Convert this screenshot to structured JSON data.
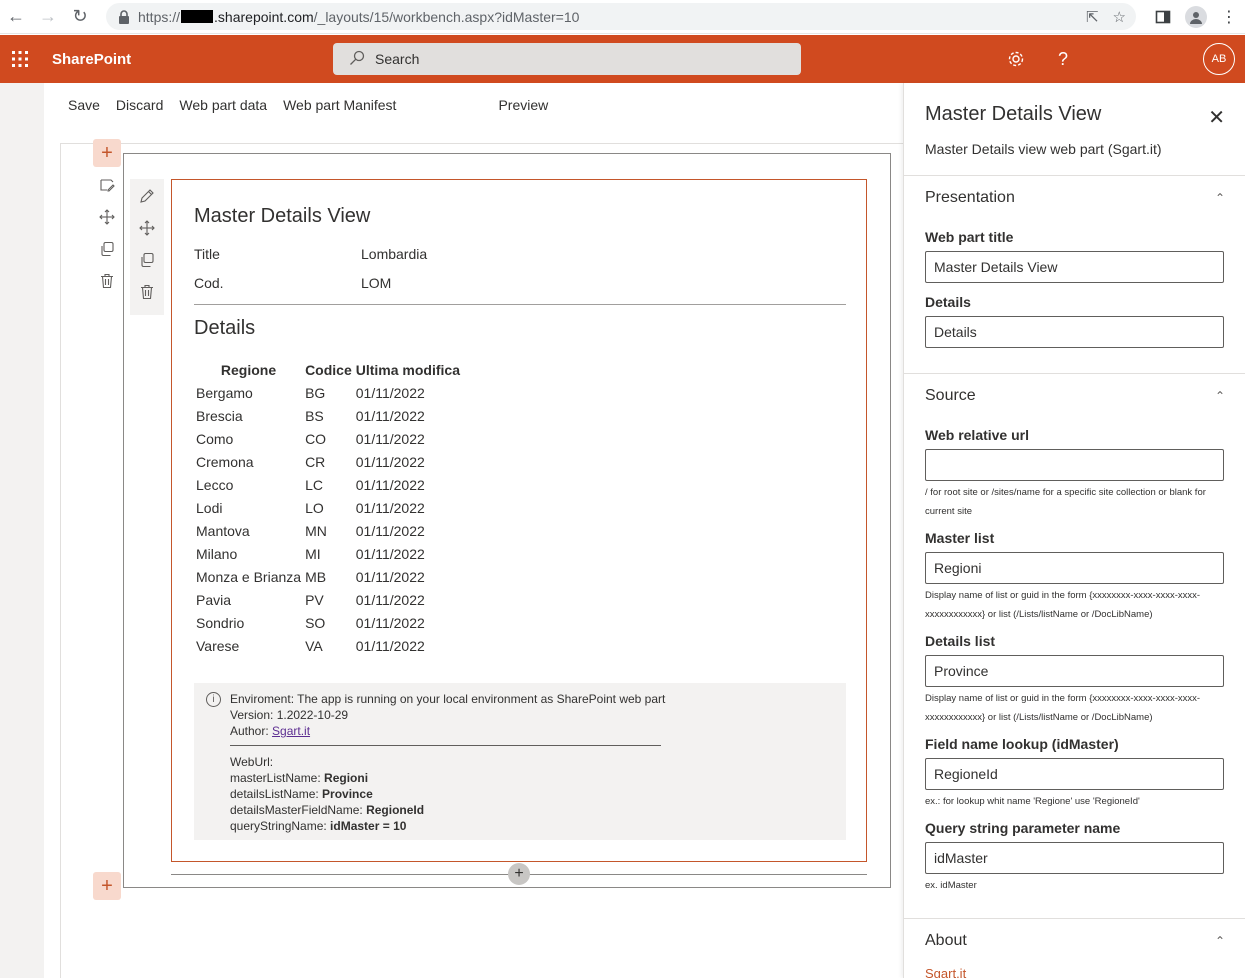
{
  "browser": {
    "url_scheme": "https://",
    "url_host": ".sharepoint.com",
    "url_path": "/_layouts/15/workbench.aspx?idMaster=10"
  },
  "suitebar": {
    "brand": "SharePoint",
    "search_placeholder": "Search",
    "help": "?",
    "avatar_initials": "AB"
  },
  "commands": {
    "save": "Save",
    "discard": "Discard",
    "web_part_data": "Web part data",
    "web_part_manifest": "Web part Manifest",
    "preview": "Preview"
  },
  "webpart": {
    "title": "Master Details View",
    "master_fields": [
      {
        "label": "Title",
        "value": "Lombardia"
      },
      {
        "label": "Cod.",
        "value": "LOM"
      }
    ],
    "details_title": "Details",
    "columns": [
      "Regione",
      "Codice",
      "Ultima modifica"
    ],
    "rows": [
      [
        "Bergamo",
        "BG",
        "01/11/2022"
      ],
      [
        "Brescia",
        "BS",
        "01/11/2022"
      ],
      [
        "Como",
        "CO",
        "01/11/2022"
      ],
      [
        "Cremona",
        "CR",
        "01/11/2022"
      ],
      [
        "Lecco",
        "LC",
        "01/11/2022"
      ],
      [
        "Lodi",
        "LO",
        "01/11/2022"
      ],
      [
        "Mantova",
        "MN",
        "01/11/2022"
      ],
      [
        "Milano",
        "MI",
        "01/11/2022"
      ],
      [
        "Monza e Brianza",
        "MB",
        "01/11/2022"
      ],
      [
        "Pavia",
        "PV",
        "01/11/2022"
      ],
      [
        "Sondrio",
        "SO",
        "01/11/2022"
      ],
      [
        "Varese",
        "VA",
        "01/11/2022"
      ]
    ],
    "info": {
      "environment": "Enviroment: The app is running on your local environment as SharePoint web part",
      "version": "Version: 1.2022-10-29",
      "author_label": "Author: ",
      "author_link": "Sgart.it",
      "weburl_label": "WebUrl:",
      "master_list_label": "masterListName: ",
      "master_list_value": "Regioni",
      "details_list_label": "detailsListName: ",
      "details_list_value": "Province",
      "details_master_field_label": "detailsMasterFieldName: ",
      "details_master_field_value": "RegioneId",
      "query_string_label": "queryStringName: ",
      "query_string_value": "idMaster = 10"
    }
  },
  "pane": {
    "title": "Master Details View",
    "description": "Master Details view web part (Sgart.it)",
    "presentation": {
      "header": "Presentation",
      "web_part_title_label": "Web part title",
      "web_part_title_value": "Master Details View",
      "details_label": "Details",
      "details_value": "Details"
    },
    "source": {
      "header": "Source",
      "web_relative_url_label": "Web relative url",
      "web_relative_url_value": "",
      "web_relative_url_help": "/ for root site or /sites/name for a specific site collection or blank for current site",
      "master_list_label": "Master list",
      "master_list_value": "Regioni",
      "master_list_help": "Display name of list or guid in the form {xxxxxxxx-xxxx-xxxx-xxxx-xxxxxxxxxxxx} or list (/Lists/listName or /DocLibName)",
      "details_list_label": "Details list",
      "details_list_value": "Province",
      "details_list_help": "Display name of list or guid in the form {xxxxxxxx-xxxx-xxxx-xxxx-xxxxxxxxxxxx} or list (/Lists/listName or /DocLibName)",
      "field_lookup_label": "Field name lookup (idMaster)",
      "field_lookup_value": "RegioneId",
      "field_lookup_help": "ex.: for lookup whit name 'Regione' use 'RegioneId'",
      "query_param_label": "Query string parameter name",
      "query_param_value": "idMaster",
      "query_param_help": "ex. idMaster"
    },
    "about": {
      "header": "About",
      "link": "Sgart.it"
    }
  },
  "colors": {
    "suitebar": "#d04a1f",
    "accent": "#c4562b",
    "link": "#5c2d91"
  }
}
